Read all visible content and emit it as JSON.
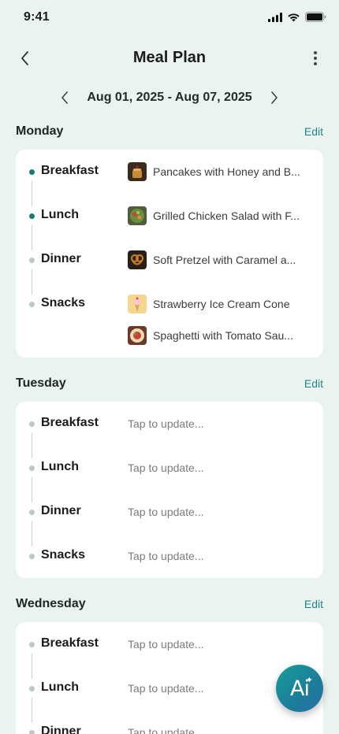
{
  "status_bar": {
    "time": "9:41"
  },
  "header": {
    "title": "Meal Plan"
  },
  "date_range": {
    "label": "Aug 01, 2025 - Aug 07, 2025"
  },
  "edit_label": "Edit",
  "days": [
    {
      "name": "Monday",
      "meals": [
        {
          "label": "Breakfast",
          "active": true,
          "foods": [
            "Pancakes with Honey and B..."
          ]
        },
        {
          "label": "Lunch",
          "active": true,
          "foods": [
            "Grilled Chicken Salad with F..."
          ]
        },
        {
          "label": "Dinner",
          "active": false,
          "foods": [
            "Soft Pretzel with Caramel a..."
          ]
        },
        {
          "label": "Snacks",
          "active": false,
          "foods": [
            "Strawberry Ice Cream Cone",
            "Spaghetti with Tomato Sau..."
          ]
        }
      ]
    },
    {
      "name": "Tuesday",
      "meals": [
        {
          "label": "Breakfast",
          "placeholder": "Tap to update..."
        },
        {
          "label": "Lunch",
          "placeholder": "Tap to update..."
        },
        {
          "label": "Dinner",
          "placeholder": "Tap to update..."
        },
        {
          "label": "Snacks",
          "placeholder": "Tap to update..."
        }
      ]
    },
    {
      "name": "Wednesday",
      "meals": [
        {
          "label": "Breakfast",
          "placeholder": "Tap to update..."
        },
        {
          "label": "Lunch",
          "placeholder": "Tap to update..."
        },
        {
          "label": "Dinner",
          "placeholder": "Tap to update..."
        }
      ]
    }
  ],
  "ai_button": {
    "label": "Ai",
    "icon": "sparkle-icon"
  },
  "colors": {
    "background": "#ebf3f0",
    "accent": "#1a8a86",
    "active_dot": "#1a7a72",
    "inactive_dot": "#bcc7c4"
  }
}
